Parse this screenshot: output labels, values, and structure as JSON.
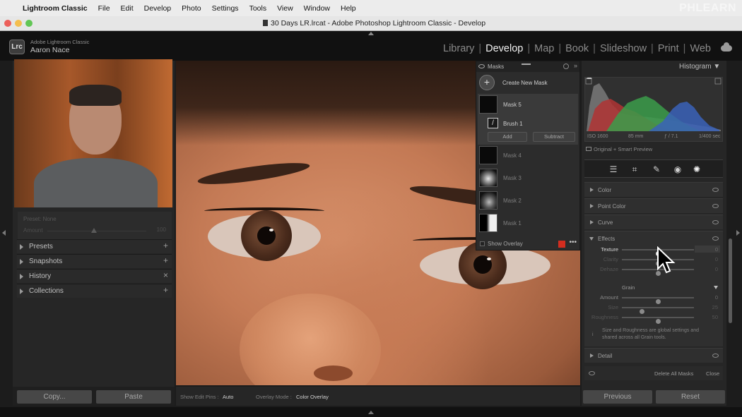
{
  "menubar": {
    "items": [
      "Lightroom Classic",
      "File",
      "Edit",
      "Develop",
      "Photo",
      "Settings",
      "Tools",
      "View",
      "Window",
      "Help"
    ],
    "brand": "PHLEARN"
  },
  "window": {
    "title": "30 Days LR.lrcat - Adobe Photoshop Lightroom Classic - Develop"
  },
  "identity": {
    "badge": "Lrc",
    "app_name": "Adobe Lightroom Classic",
    "user": "Aaron Nace"
  },
  "modules": [
    "Library",
    "Develop",
    "Map",
    "Book",
    "Slideshow",
    "Print",
    "Web"
  ],
  "active_module": "Develop",
  "left_panel": {
    "navigator": {
      "preset_label": "Preset: None",
      "amount_label": "Amount",
      "amount_value": "100",
      "amount_fraction": 0.5
    },
    "sections": [
      {
        "label": "Presets",
        "action": "+"
      },
      {
        "label": "Snapshots",
        "action": "+"
      },
      {
        "label": "History",
        "action": "×"
      },
      {
        "label": "Collections",
        "action": "+"
      }
    ],
    "copy_button": "Copy...",
    "paste_button": "Paste"
  },
  "masks_panel": {
    "title": "Masks",
    "create_label": "Create New Mask",
    "selected_mask": "Mask 5",
    "brush_label": "Brush 1",
    "add_button": "Add",
    "subtract_button": "Subtract",
    "other_masks": [
      "Mask 4",
      "Mask 3",
      "Mask 2",
      "Mask 1"
    ],
    "show_overlay_label": "Show Overlay",
    "overlay_color": "#d32d1f"
  },
  "toolbar": {
    "edit_pins_label": "Show Edit Pins :",
    "edit_pins_value": "Auto",
    "overlay_mode_label": "Overlay Mode :",
    "overlay_mode_value": "Color Overlay"
  },
  "right_panel": {
    "histogram_title": "Histogram",
    "histogram_info": {
      "iso": "ISO 1600",
      "focal": "85 mm",
      "aperture": "ƒ / 7.1",
      "shutter": "1/400 sec"
    },
    "preview_status": "Original + Smart Preview",
    "tools": [
      "sliders-icon",
      "crop-icon",
      "heal-icon",
      "red-eye-icon",
      "masking-icon"
    ],
    "collapsed_sections": [
      "Color",
      "Point Color",
      "Curve"
    ],
    "effects": {
      "title": "Effects",
      "sliders": [
        {
          "label": "Texture",
          "value": "0",
          "fraction": 0.5
        },
        {
          "label": "Clarity",
          "value": "0",
          "fraction": 0.5
        },
        {
          "label": "Dehaze",
          "value": "0",
          "fraction": 0.5
        }
      ],
      "grain_title": "Grain",
      "grain_sliders": [
        {
          "label": "Amount",
          "value": "0",
          "fraction": 0.5
        },
        {
          "label": "Size",
          "value": "25",
          "fraction": 0.27
        },
        {
          "label": "Roughness",
          "value": "50",
          "fraction": 0.5
        }
      ],
      "note": "Size and Roughness are global settings and shared across all Grain tools."
    },
    "detail_section": "Detail",
    "delete_all": "Delete All Masks",
    "close": "Close",
    "previous_button": "Previous",
    "reset_button": "Reset"
  }
}
